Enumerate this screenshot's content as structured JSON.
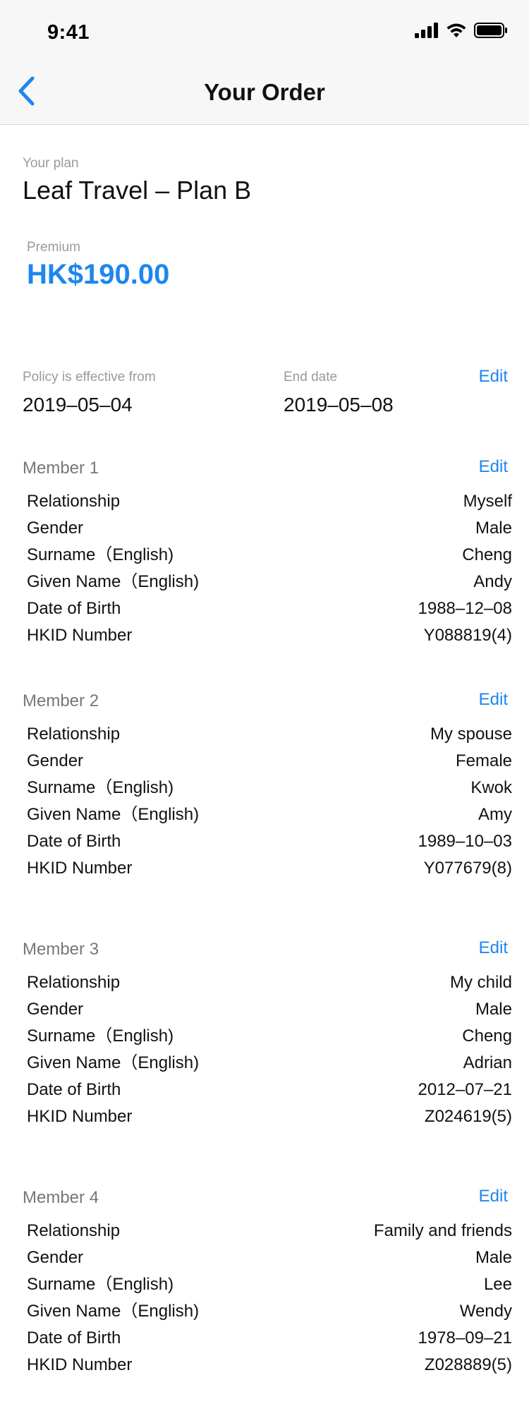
{
  "status_bar": {
    "time": "9:41",
    "icons": [
      "signal-icon",
      "wifi-icon",
      "battery-icon"
    ]
  },
  "nav": {
    "back_icon": "chevron-left-icon",
    "title": "Your Order"
  },
  "plan": {
    "label": "Your plan",
    "name": "Leaf Travel – Plan B"
  },
  "premium": {
    "label": "Premium",
    "value": "HK$190.00"
  },
  "policy": {
    "start_label": "Policy is effective from",
    "start_value": "2019–05–04",
    "end_label": "End date",
    "end_value": "2019–05–08",
    "edit_label": "Edit"
  },
  "members": [
    {
      "title": "Member 1",
      "edit_label": "Edit",
      "rows": [
        {
          "label": "Relationship",
          "value": "Myself"
        },
        {
          "label": "Gender",
          "value": "Male"
        },
        {
          "label": "Surname（English)",
          "value": "Cheng"
        },
        {
          "label": "Given Name（English)",
          "value": "Andy"
        },
        {
          "label": "Date of Birth",
          "value": "1988–12–08"
        },
        {
          "label": "HKID Number",
          "value": "Y088819(4)"
        }
      ]
    },
    {
      "title": "Member 2",
      "edit_label": "Edit",
      "rows": [
        {
          "label": "Relationship",
          "value": "My spouse"
        },
        {
          "label": "Gender",
          "value": "Female"
        },
        {
          "label": "Surname（English)",
          "value": "Kwok"
        },
        {
          "label": "Given Name（English)",
          "value": "Amy"
        },
        {
          "label": "Date of Birth",
          "value": "1989–10–03"
        },
        {
          "label": "HKID Number",
          "value": "Y077679(8)"
        }
      ]
    },
    {
      "title": "Member 3",
      "edit_label": "Edit",
      "rows": [
        {
          "label": "Relationship",
          "value": "My child"
        },
        {
          "label": "Gender",
          "value": "Male"
        },
        {
          "label": "Surname（English)",
          "value": "Cheng"
        },
        {
          "label": "Given Name（English)",
          "value": "Adrian"
        },
        {
          "label": "Date of Birth",
          "value": "2012–07–21"
        },
        {
          "label": "HKID Number",
          "value": "Z024619(5)"
        }
      ]
    },
    {
      "title": "Member 4",
      "edit_label": "Edit",
      "rows": [
        {
          "label": "Relationship",
          "value": "Family and friends"
        },
        {
          "label": "Gender",
          "value": "Male"
        },
        {
          "label": "Surname（English)",
          "value": "Lee"
        },
        {
          "label": "Given Name（English)",
          "value": "Wendy"
        },
        {
          "label": "Date of Birth",
          "value": "1978–09–21"
        },
        {
          "label": "HKID Number",
          "value": "Z028889(5)"
        }
      ]
    }
  ]
}
